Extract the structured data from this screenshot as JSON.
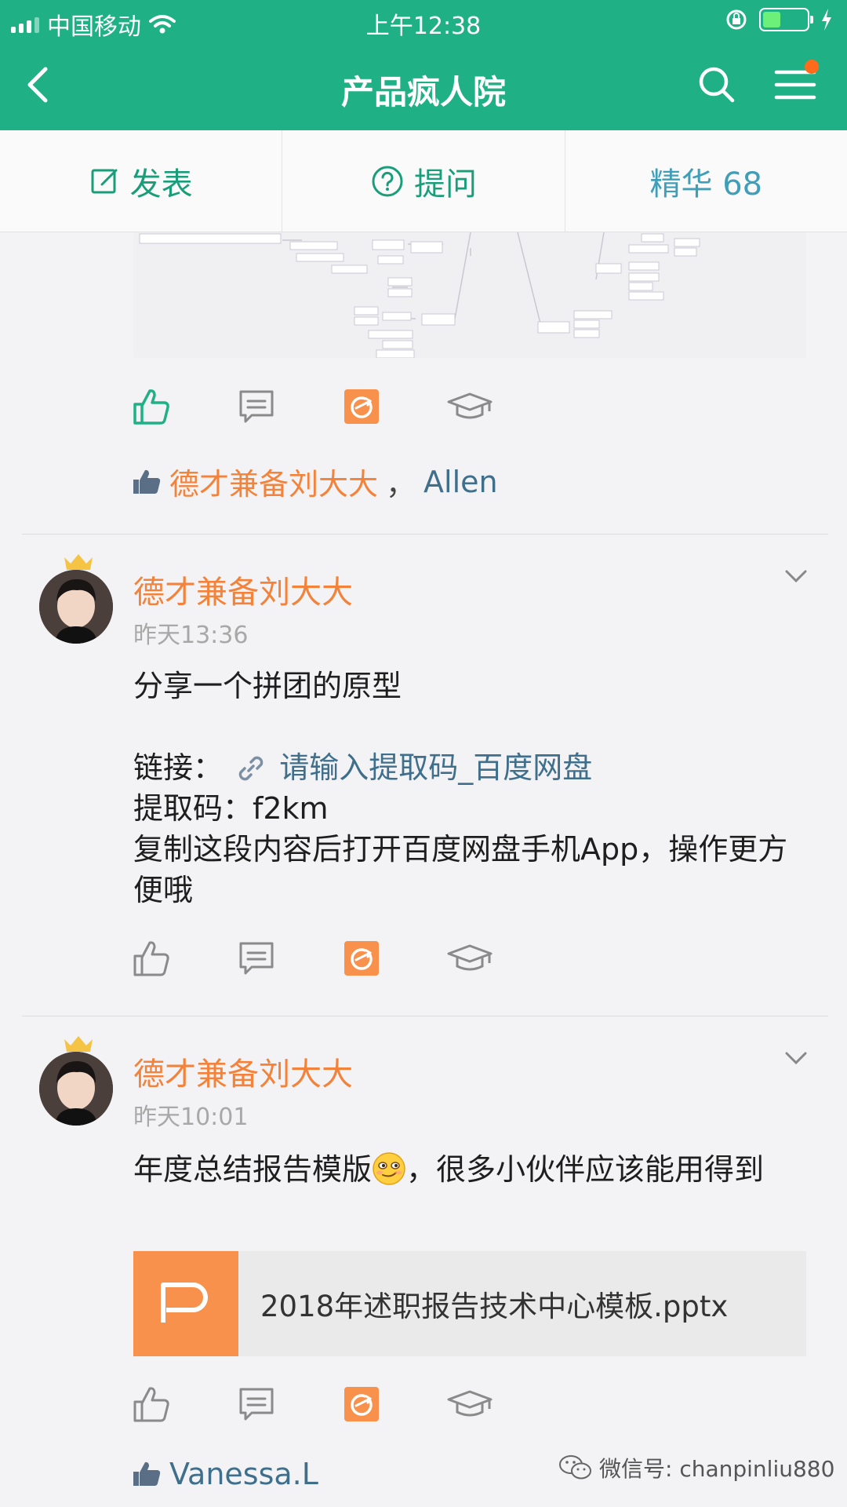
{
  "status_bar": {
    "carrier": "中国移动",
    "time": "上午12:38"
  },
  "header": {
    "title": "产品疯人院"
  },
  "actions": {
    "post": "发表",
    "ask": "提问",
    "featured": "精华 68"
  },
  "post0": {
    "likes": {
      "names": [
        "德才兼备刘大大",
        "Allen"
      ],
      "separator": "，"
    }
  },
  "post1": {
    "author": "德才兼备刘大大",
    "time": "昨天13:36",
    "line1": "分享一个拼团的原型",
    "link_prefix": "链接：",
    "link_text": "请输入提取码_百度网盘",
    "code_line": "提取码：f2km",
    "line3": "复制这段内容后打开百度网盘手机App，操作更方便哦"
  },
  "post2": {
    "author": "德才兼备刘大大",
    "time": "昨天10:01",
    "text_before": "年度总结报告模版",
    "text_after": "，很多小伙伴应该能用得到",
    "file_name": "2018年述职报告技术中心模板.pptx",
    "likes": {
      "names": [
        "Vanessa.L"
      ]
    }
  },
  "watermark": "微信号: chanpinliu880",
  "colors": {
    "brand": "#1fb185",
    "author": "#f3823b",
    "link": "#3f6f8b",
    "file_icon": "#f7914b"
  }
}
